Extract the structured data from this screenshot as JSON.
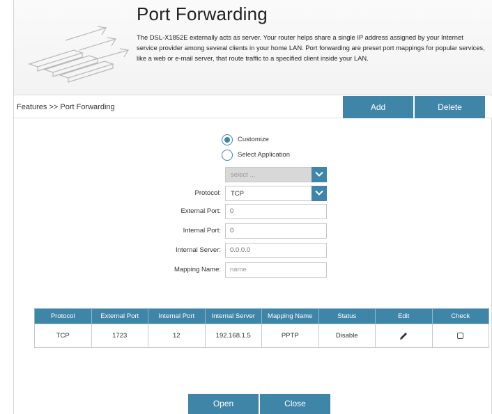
{
  "header": {
    "title": "Port Forwarding",
    "description": "The DSL-X1852E externally acts as server. Your router helps share a single IP address assigned by your Internet service provider among several clients in your home LAN. Port forwarding are preset port mappings for popular services, like a web or e-mail server, that route traffic to a specified client inside your LAN.",
    "art_icon": "stairs-arrows-icon"
  },
  "breadcrumb": "Features >> Port Forwarding",
  "toolbar": {
    "add_label": "Add",
    "delete_label": "Delete"
  },
  "form": {
    "mode_options": [
      {
        "label": "Customize",
        "selected": true
      },
      {
        "label": "Select Application",
        "selected": false
      }
    ],
    "application_select": {
      "value": "select ...",
      "disabled": true
    },
    "protocol": {
      "label": "Protocol:",
      "value": "TCP"
    },
    "external_port": {
      "label": "External Port:",
      "value": "0"
    },
    "internal_port": {
      "label": "Internal Port:",
      "value": "0"
    },
    "internal_server": {
      "label": "Internal Server:",
      "value": "0.0.0.0"
    },
    "mapping_name": {
      "label": "Mapping Name:",
      "placeholder": "name"
    }
  },
  "table": {
    "columns": [
      "Protocol",
      "External Port",
      "Internal Port",
      "Internal Server",
      "Mapping Name",
      "Status",
      "Edit",
      "Check"
    ],
    "rows": [
      {
        "protocol": "TCP",
        "external_port": "1723",
        "internal_port": "12",
        "internal_server": "192.168.1.5",
        "mapping_name": "PPTP",
        "status": "Disable",
        "edit_icon": "pencil-icon",
        "checked": false
      }
    ]
  },
  "footer": {
    "open_label": "Open",
    "close_label": "Close"
  },
  "colors": {
    "accent": "#3e85a8",
    "header_bg": "#f5f5f5",
    "border": "#c8c8c8"
  }
}
